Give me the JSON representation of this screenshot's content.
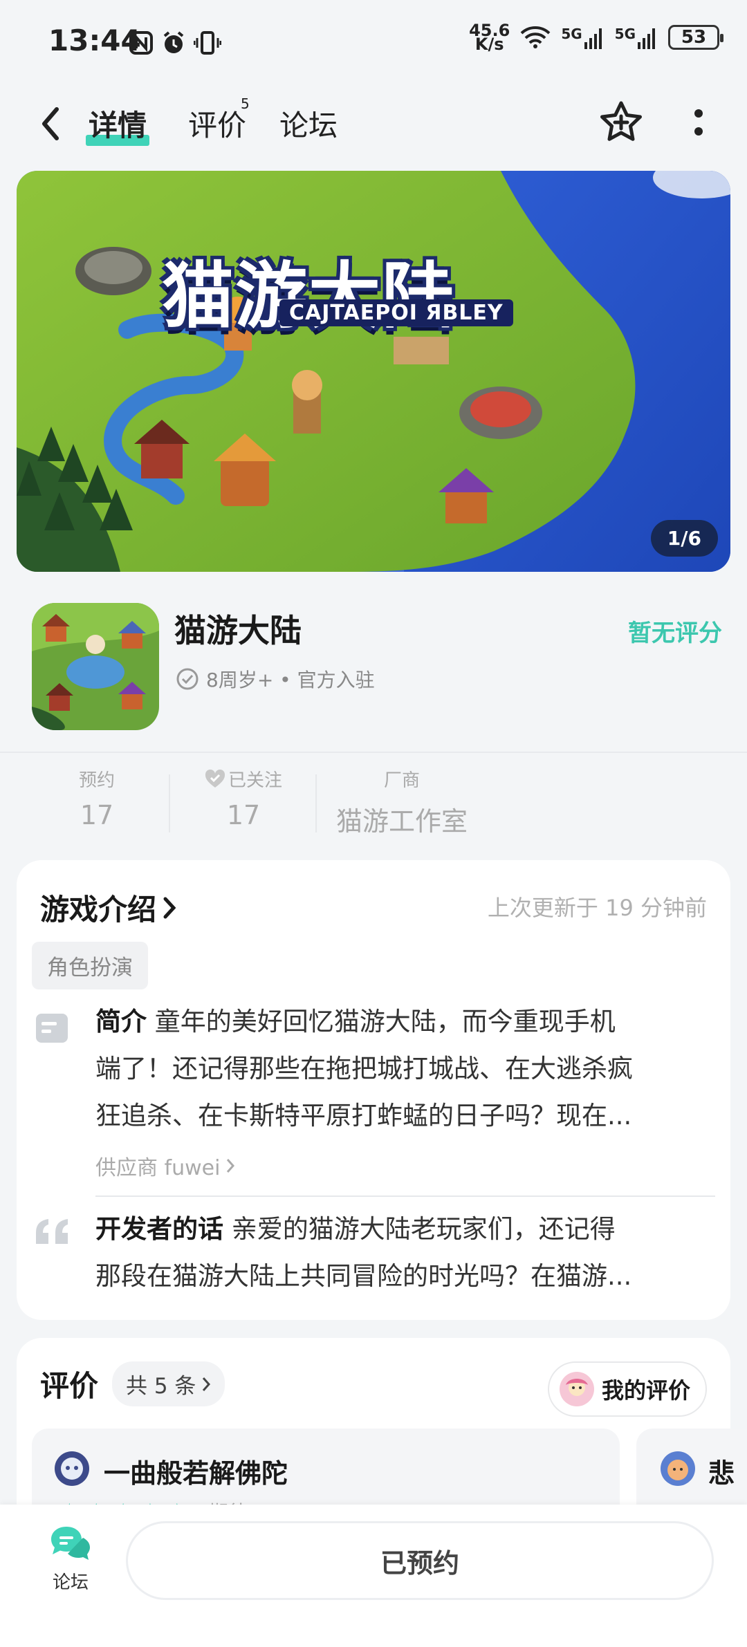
{
  "status_bar": {
    "time": "13:44",
    "net_speed_top": "45.6",
    "net_speed_bottom": "K/s",
    "signal1": "5G",
    "signal2": "5G",
    "battery": "53"
  },
  "nav": {
    "tabs": [
      {
        "label": "详情",
        "active": true
      },
      {
        "label": "评价",
        "badge": "5"
      },
      {
        "label": "论坛"
      }
    ]
  },
  "banner": {
    "title_art": "猫游大陆",
    "subtitle_art": "CAJTAEPOI ЯBLEY",
    "pager": "1/6"
  },
  "app": {
    "name": "猫游大陆",
    "meta": "8周岁+ • 官方入驻",
    "rating": "暂无评分"
  },
  "stats": [
    {
      "label": "预约",
      "value": "17"
    },
    {
      "label": "已关注",
      "value": "17"
    },
    {
      "label": "厂商",
      "value": "猫游工作室"
    }
  ],
  "intro": {
    "title": "游戏介绍",
    "updated": "上次更新于 19 分钟前",
    "tag": "角色扮演",
    "summary_label": "简介",
    "summary_line1": "童年的美好回忆猫游大陆，而今重现手机",
    "summary_line2": "端了！还记得那些在拖把城打城战、在大逃杀疯",
    "summary_line3": "狂追杀、在卡斯特平原打蚱蜢的日子吗？现在...",
    "supplier": "供应商 fuwei",
    "dev_label": "开发者的话",
    "dev_line1": "亲爱的猫游大陆老玩家们，还记得",
    "dev_line2": "那段在猫游大陆上共同冒险的时光吗？在猫游..."
  },
  "reviews": {
    "title": "评价",
    "count": "共 5 条",
    "my_review": "我的评价",
    "items": [
      {
        "user": "一曲般若解佛陀",
        "note": "期待"
      },
      {
        "user": "悲"
      }
    ]
  },
  "bottom": {
    "forum_label": "论坛",
    "reserve_label": "已预约"
  },
  "colors": {
    "accent": "#3fd3b8",
    "rating": "#3cc7ae",
    "background": "#f3f5f7"
  }
}
